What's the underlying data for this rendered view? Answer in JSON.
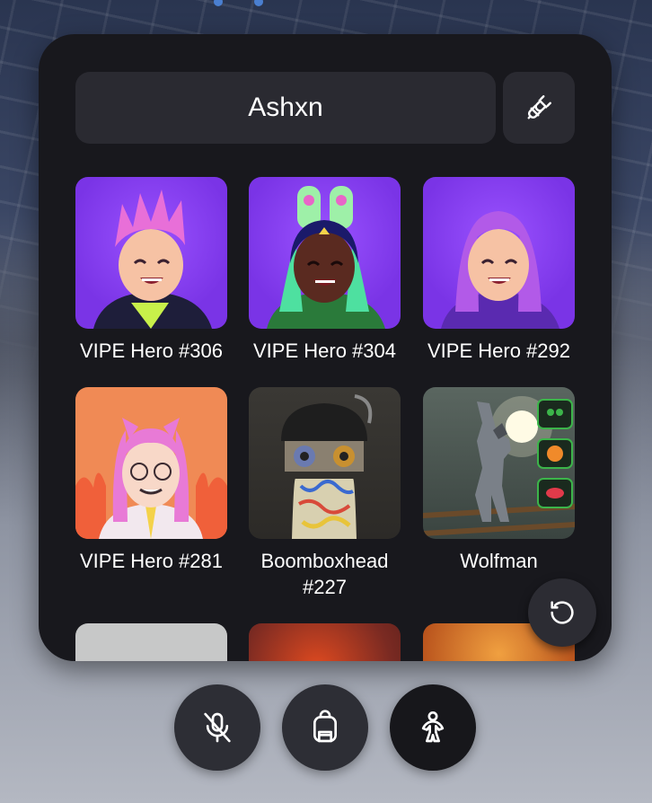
{
  "header": {
    "username": "Ashxn",
    "connect_icon": "plug-connect-icon"
  },
  "avatars": [
    {
      "name": "VIPE Hero #306",
      "bg": "#7a34e6",
      "hair": "#e86fd8"
    },
    {
      "name": "VIPE Hero #304",
      "bg": "#7a34e6",
      "hair": "#1a1a6a"
    },
    {
      "name": "VIPE Hero #292",
      "bg": "#7a34e6",
      "hair": "#b25ae8"
    },
    {
      "name": "VIPE Hero #281",
      "bg": "#f08a55",
      "hair": "#e87ad6"
    },
    {
      "name": "Boomboxhead #227",
      "bg": "#2c2a27"
    },
    {
      "name": "Wolfman",
      "bg": "#44504a"
    },
    {
      "name": "",
      "bg": "#c7c8c8"
    },
    {
      "name": "",
      "bg": "#7a2a22"
    },
    {
      "name": "",
      "bg": "#b8521c"
    }
  ],
  "controls": {
    "reset_icon": "reset-rotate-icon",
    "mic_icon": "mic-muted-icon",
    "backpack_icon": "backpack-icon",
    "avatar_icon": "avatar-person-icon"
  }
}
